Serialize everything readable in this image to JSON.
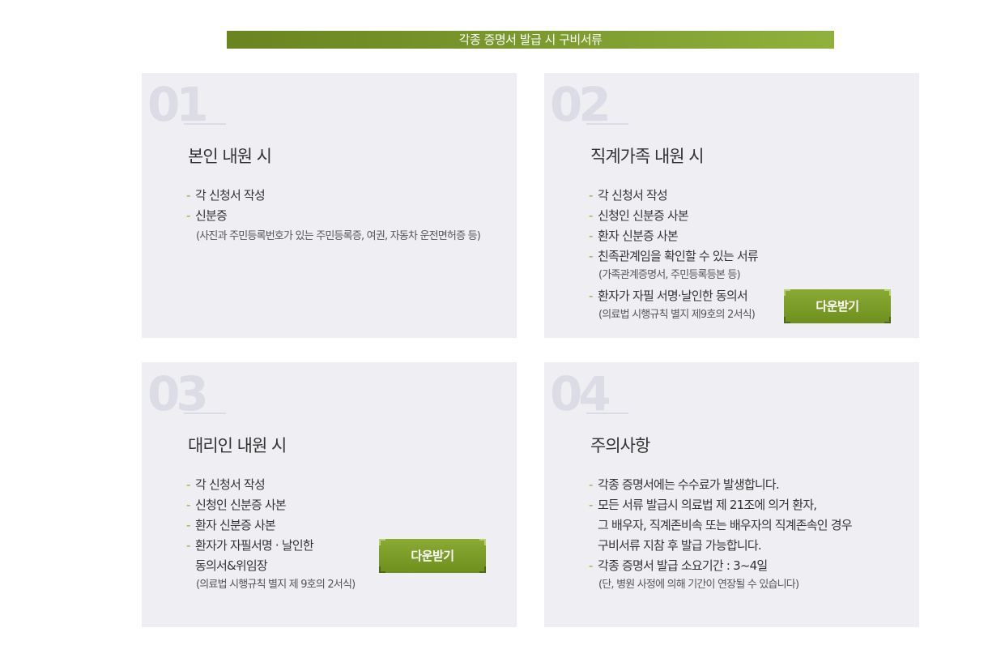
{
  "header": {
    "title": "각종 증명서 발급 시 구비서류"
  },
  "cards": [
    {
      "number": "01",
      "title": "본인 내원 시",
      "items": [
        {
          "text": "각 신청서 작성"
        },
        {
          "text": "신분증",
          "note": "(사진과 주민등록번호가 있는 주민등록증, 여권, 자동차 운전면허증 등)"
        }
      ]
    },
    {
      "number": "02",
      "title": "직계가족 내원 시",
      "items": [
        {
          "text": "각 신청서 작성"
        },
        {
          "text": "신청인 신분증 사본"
        },
        {
          "text": "환자 신분증 사본"
        },
        {
          "text": "친족관계임을 확인할 수 있는 서류",
          "note": "(가족관계증명서, 주민등록등본 등)"
        },
        {
          "text": "환자가 자필 서명·날인한 동의서",
          "note": "(의료법 시행규칙 별지 제9호의 2서식)"
        }
      ],
      "download_label": "다운받기"
    },
    {
      "number": "03",
      "title": "대리인 내원 시",
      "items": [
        {
          "text": "각 신청서 작성"
        },
        {
          "text": "신청인 신분증 사본"
        },
        {
          "text": "환자 신분증 사본"
        },
        {
          "text": "환자가 자필서명 · 날인한",
          "text2": "동의서&위임장",
          "note": "(의료법 시행규칙 별지 제 9호의 2서식)"
        }
      ],
      "download_label": "다운받기"
    },
    {
      "number": "04",
      "title": "주의사항",
      "items": [
        {
          "text": "각종 증명서에는 수수료가 발생합니다."
        },
        {
          "text": "모든 서류 발급시 의료법 제 21조에 의거 환자,",
          "text2": "그 배우자, 직계존비속 또는 배우자의 직계존속인 경우",
          "text3": "구비서류 지참 후 발급 가능합니다."
        },
        {
          "text": "각종 증명서 발급 소요기간 : 3~4일",
          "note": "(단, 병원 사정에 의해 기간이 연장될 수 있습니다)"
        }
      ]
    }
  ],
  "colors": {
    "accent": "#7a9a2c",
    "card_bg": "#efeff3",
    "number": "#dcdce6"
  }
}
